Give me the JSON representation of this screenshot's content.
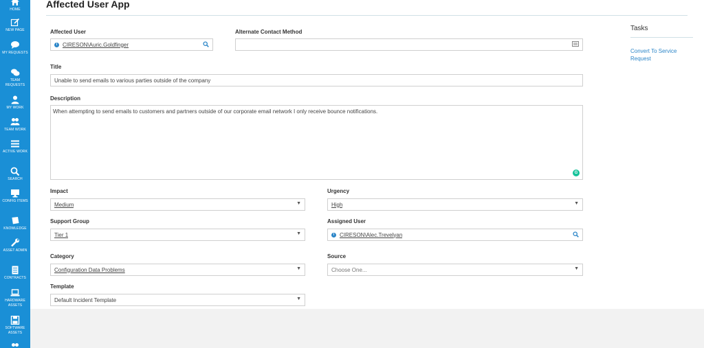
{
  "sidebar": {
    "items": [
      {
        "label": "Home",
        "icon": "home-icon"
      },
      {
        "label": "New Page",
        "icon": "edit-icon"
      },
      {
        "label": "My Requests",
        "icon": "chat-bubble-icon"
      },
      {
        "label": "Team Requests",
        "icon": "chat-bubbles-icon"
      },
      {
        "label": "My Work",
        "icon": "user-icon"
      },
      {
        "label": "Team Work",
        "icon": "users-icon"
      },
      {
        "label": "Active Work",
        "icon": "list-icon"
      },
      {
        "label": "Search",
        "icon": "search-icon"
      },
      {
        "label": "Config Items",
        "icon": "monitor-icon"
      },
      {
        "label": "Knowledge",
        "icon": "book-icon"
      },
      {
        "label": "Asset Admin",
        "icon": "wrench-icon"
      },
      {
        "label": "Contracts",
        "icon": "document-icon"
      },
      {
        "label": "Hardware Assets",
        "icon": "laptop-icon"
      },
      {
        "label": "Software Assets",
        "icon": "floppy-icon"
      }
    ]
  },
  "page": {
    "title": "Affected User App"
  },
  "form": {
    "affected_user": {
      "label": "Affected User",
      "value": "CIRESON\\Auric.Goldfinger"
    },
    "alternate_contact": {
      "label": "Alternate Contact Method",
      "value": ""
    },
    "title": {
      "label": "Title",
      "value": "Unable to send emails to various parties outside of the company"
    },
    "description": {
      "label": "Description",
      "value": "When attempting to send emails to customers and partners outside of our corporate email network I only receive bounce notifications."
    },
    "impact": {
      "label": "Impact",
      "value": "Medium"
    },
    "urgency": {
      "label": "Urgency",
      "value": "High"
    },
    "support_group": {
      "label": "Support Group",
      "value": "Tier 1"
    },
    "assigned_user": {
      "label": "Assigned User",
      "value": "CIRESON\\Alec.Trevelyan"
    },
    "category": {
      "label": "Category",
      "value": "Configuration Data Problems"
    },
    "source": {
      "label": "Source",
      "placeholder": "Choose One..."
    },
    "template": {
      "label": "Template",
      "value": "Default Incident Template"
    }
  },
  "tasks": {
    "title": "Tasks",
    "links": [
      "Convert To Service Request"
    ]
  },
  "colors": {
    "sidebar": "#1a8fd6",
    "link": "#2c86c8",
    "grammarly": "#15c39a"
  }
}
